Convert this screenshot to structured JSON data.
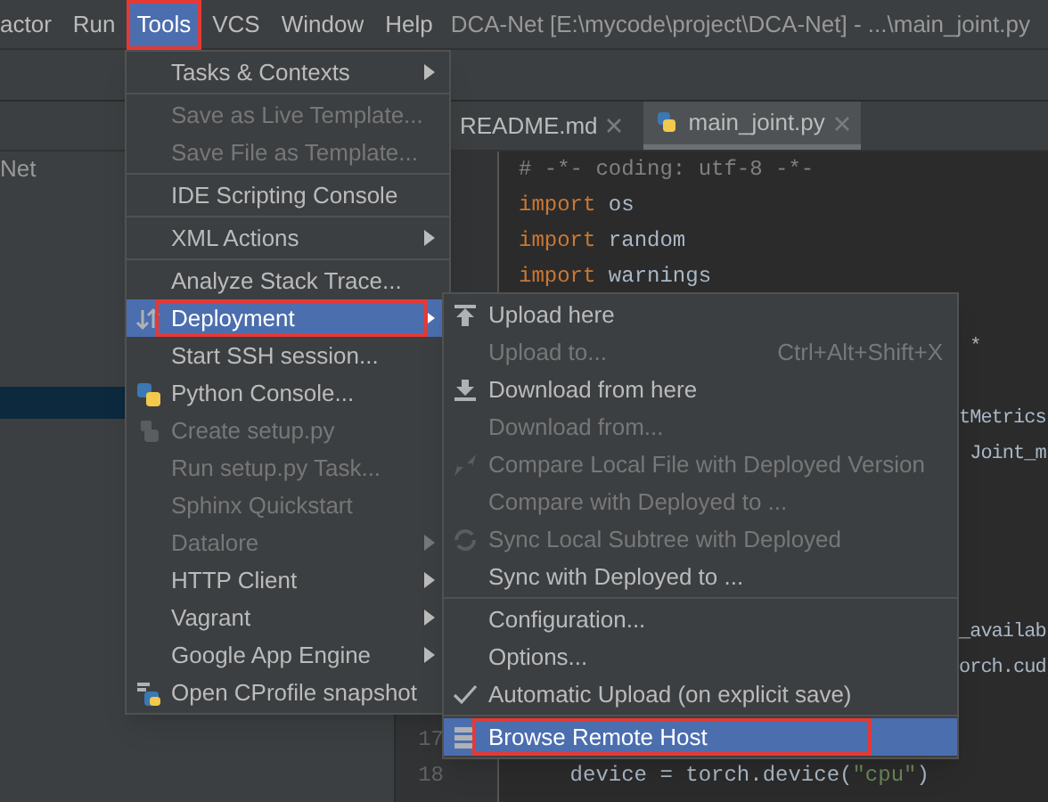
{
  "menubar": {
    "items": [
      {
        "label": "actor",
        "selected": false,
        "annotated": false
      },
      {
        "label": "Run",
        "selected": false,
        "annotated": false
      },
      {
        "label": "Tools",
        "selected": true,
        "annotated": true
      },
      {
        "label": "VCS",
        "selected": false,
        "annotated": false
      },
      {
        "label": "Window",
        "selected": false,
        "annotated": false
      },
      {
        "label": "Help",
        "selected": false,
        "annotated": false
      }
    ],
    "title": "DCA-Net [E:\\mycode\\project\\DCA-Net] - ...\\main_joint.py"
  },
  "project_panel": {
    "root_label": "Net"
  },
  "editor_tabs": [
    {
      "label": "README.md",
      "selected": false
    },
    {
      "label": "main_joint.py",
      "selected": true
    }
  ],
  "code_lines": [
    {
      "kind": "full",
      "segments": [
        {
          "kind": "comment",
          "text": "# -*- coding: utf-8 -*-"
        }
      ]
    },
    {
      "kind": "full",
      "segments": [
        {
          "kind": "keyword",
          "text": "import"
        },
        {
          "kind": "plain",
          "text": " os"
        }
      ]
    },
    {
      "kind": "full",
      "segments": [
        {
          "kind": "keyword",
          "text": "import"
        },
        {
          "kind": "plain",
          "text": " random"
        }
      ]
    },
    {
      "kind": "full",
      "segments": [
        {
          "kind": "keyword",
          "text": "import"
        },
        {
          "kind": "plain",
          "text": " warnings"
        }
      ]
    },
    {
      "kind": "covered"
    },
    {
      "kind": "fragment",
      "segments": [
        {
          "kind": "plain",
          "text": " *"
        }
      ]
    },
    {
      "kind": "covered"
    },
    {
      "kind": "fragment",
      "segments": [
        {
          "kind": "plain",
          "text": "tMetrics"
        }
      ]
    },
    {
      "kind": "fragment",
      "segments": [
        {
          "kind": "plain",
          "text": " Joint_m"
        }
      ]
    },
    {
      "kind": "covered"
    },
    {
      "kind": "covered"
    },
    {
      "kind": "covered"
    },
    {
      "kind": "covered"
    },
    {
      "kind": "fragment",
      "segments": [
        {
          "kind": "plain",
          "text": "_availab"
        }
      ]
    },
    {
      "kind": "fragment",
      "segments": [
        {
          "kind": "plain",
          "text": "orch.cud"
        }
      ]
    },
    {
      "kind": "covered"
    },
    {
      "kind": "numbered",
      "number": "17"
    },
    {
      "kind": "full",
      "number": "18",
      "segments": [
        {
          "kind": "plain",
          "text": "    device = torch.device("
        },
        {
          "kind": "string",
          "text": "\"cpu\""
        },
        {
          "kind": "plain",
          "text": ")"
        }
      ]
    }
  ],
  "tools_menu": {
    "groups": [
      [
        {
          "label": "Tasks & Contexts",
          "disabled": false,
          "submenu": true,
          "selected": false,
          "annotated": false
        }
      ],
      [
        {
          "label": "Save as Live Template...",
          "disabled": true,
          "submenu": false,
          "selected": false,
          "annotated": false
        },
        {
          "label": "Save File as Template...",
          "disabled": true,
          "submenu": false,
          "selected": false,
          "annotated": false
        }
      ],
      [
        {
          "label": "IDE Scripting Console",
          "disabled": false,
          "submenu": false,
          "selected": false,
          "annotated": false
        }
      ],
      [
        {
          "label": "XML Actions",
          "disabled": false,
          "submenu": true,
          "selected": false,
          "annotated": false
        }
      ],
      [
        {
          "label": "Analyze Stack Trace...",
          "disabled": false,
          "submenu": false,
          "selected": false,
          "annotated": false
        },
        {
          "label": "Deployment",
          "disabled": false,
          "submenu": true,
          "selected": true,
          "annotated": true
        },
        {
          "label": "Start SSH session...",
          "disabled": false,
          "submenu": false,
          "selected": false,
          "annotated": false
        },
        {
          "label": "Python Console...",
          "disabled": false,
          "submenu": false,
          "selected": false,
          "annotated": false
        },
        {
          "label": "Create setup.py",
          "disabled": true,
          "submenu": false,
          "selected": false,
          "annotated": false
        },
        {
          "label": "Run setup.py Task...",
          "disabled": true,
          "submenu": false,
          "selected": false,
          "annotated": false
        },
        {
          "label": "Sphinx Quickstart",
          "disabled": true,
          "submenu": false,
          "selected": false,
          "annotated": false
        },
        {
          "label": "Datalore",
          "disabled": true,
          "submenu": true,
          "selected": false,
          "annotated": false
        },
        {
          "label": "HTTP Client",
          "disabled": false,
          "submenu": true,
          "selected": false,
          "annotated": false
        },
        {
          "label": "Vagrant",
          "disabled": false,
          "submenu": true,
          "selected": false,
          "annotated": false
        },
        {
          "label": "Google App Engine",
          "disabled": false,
          "submenu": true,
          "selected": false,
          "annotated": false
        },
        {
          "label": "Open CProfile snapshot",
          "disabled": false,
          "submenu": false,
          "selected": false,
          "annotated": false
        }
      ]
    ]
  },
  "deployment_submenu": {
    "groups": [
      [
        {
          "label": "Upload here",
          "disabled": false,
          "checked": false,
          "selected": false,
          "annotated": false
        },
        {
          "label": "Upload to...",
          "shortcut": "Ctrl+Alt+Shift+X",
          "disabled": true,
          "checked": false,
          "selected": false,
          "annotated": false
        },
        {
          "label": "Download from here",
          "disabled": false,
          "checked": false,
          "selected": false,
          "annotated": false
        },
        {
          "label": "Download from...",
          "disabled": true,
          "checked": false,
          "selected": false,
          "annotated": false
        },
        {
          "label": "Compare Local File with Deployed Version",
          "disabled": true,
          "checked": false,
          "selected": false,
          "annotated": false
        },
        {
          "label": "Compare with Deployed to ...",
          "disabled": true,
          "checked": false,
          "selected": false,
          "annotated": false
        },
        {
          "label": "Sync Local Subtree with Deployed",
          "disabled": true,
          "checked": false,
          "selected": false,
          "annotated": false
        },
        {
          "label": "Sync with Deployed to ...",
          "disabled": false,
          "checked": false,
          "selected": false,
          "annotated": false
        }
      ],
      [
        {
          "label": "Configuration...",
          "disabled": false,
          "checked": false,
          "selected": false,
          "annotated": false
        },
        {
          "label": "Options...",
          "disabled": false,
          "checked": false,
          "selected": false,
          "annotated": false
        },
        {
          "label": "Automatic Upload (on explicit save)",
          "disabled": false,
          "checked": true,
          "selected": false,
          "annotated": false
        }
      ],
      [
        {
          "label": "Browse Remote Host",
          "disabled": false,
          "checked": false,
          "selected": true,
          "annotated": true
        }
      ]
    ]
  }
}
